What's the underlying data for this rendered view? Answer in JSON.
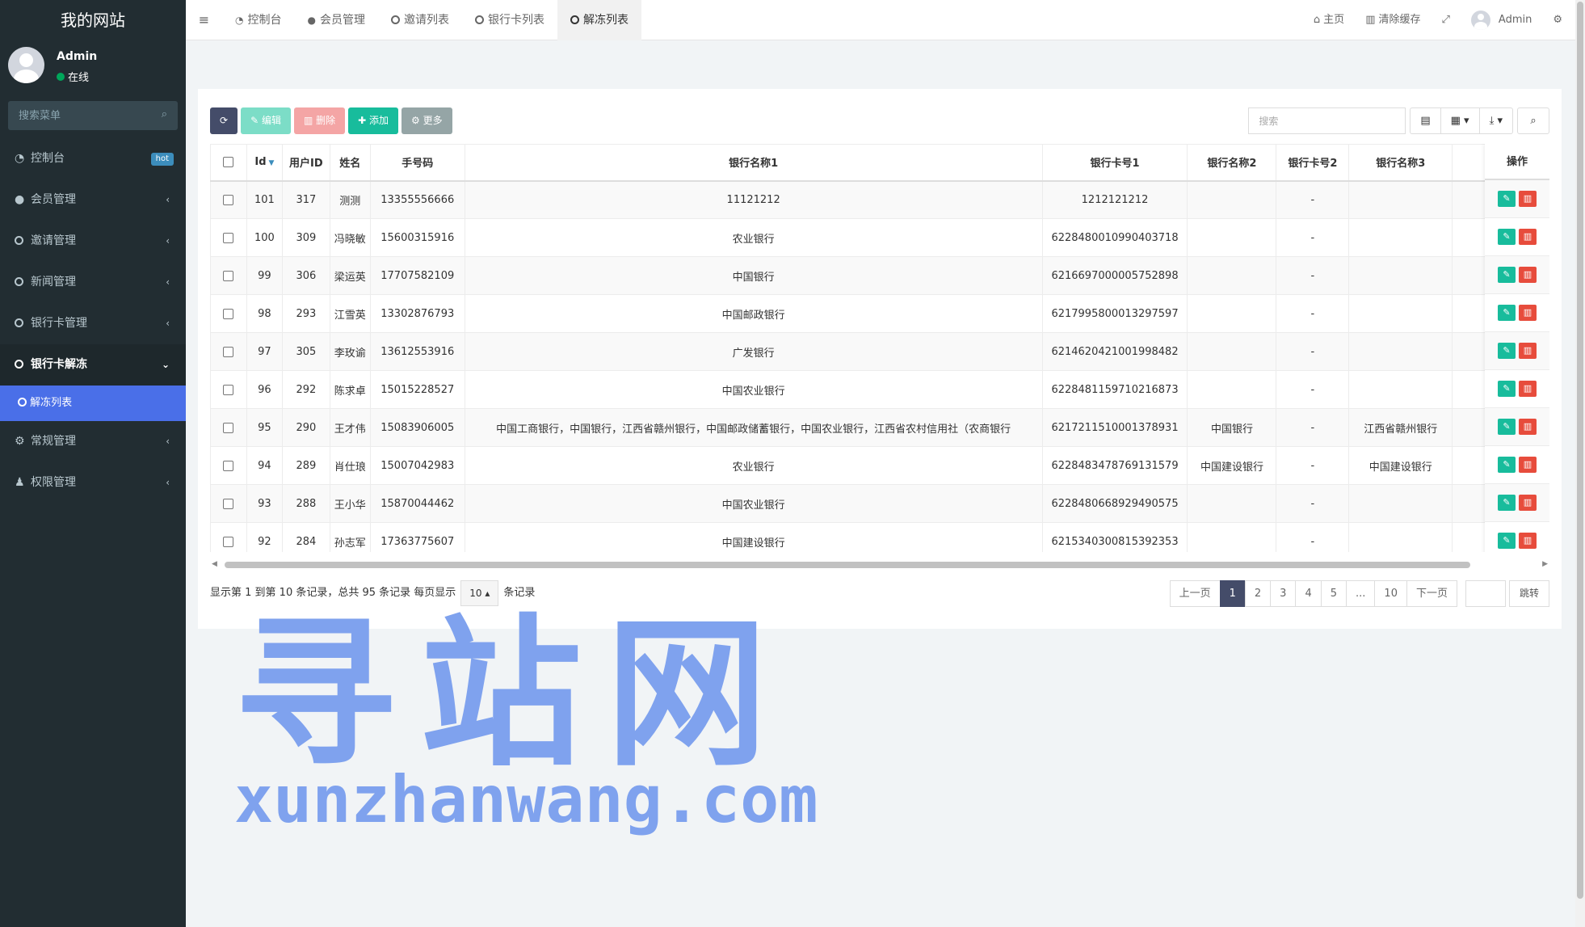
{
  "sidebar": {
    "logo": "我的网站",
    "user": {
      "name": "Admin",
      "status": "在线"
    },
    "search_placeholder": "搜索菜单",
    "items": [
      {
        "label": "控制台",
        "badge": "hot"
      },
      {
        "label": "会员管理"
      },
      {
        "label": "邀请管理"
      },
      {
        "label": "新闻管理"
      },
      {
        "label": "银行卡管理"
      },
      {
        "label": "银行卡解冻"
      },
      {
        "label": "解冻列表"
      },
      {
        "label": "常规管理"
      },
      {
        "label": "权限管理"
      }
    ]
  },
  "header": {
    "tabs": [
      "控制台",
      "会员管理",
      "邀请列表",
      "银行卡列表",
      "解冻列表"
    ],
    "home": "主页",
    "clear_cache": "清除缓存",
    "user": "Admin"
  },
  "toolbar": {
    "edit": "编辑",
    "delete": "删除",
    "add": "添加",
    "more": "更多",
    "search_placeholder": "搜索"
  },
  "table": {
    "columns": [
      "Id",
      "用户ID",
      "姓名",
      "手号码",
      "银行名称1",
      "银行卡号1",
      "银行名称2",
      "银行卡号2",
      "银行名称3"
    ],
    "op_header": "操作",
    "rows": [
      [
        "101",
        "317",
        "测测",
        "13355556666",
        "11121212",
        "1212121212",
        "",
        "-",
        ""
      ],
      [
        "100",
        "309",
        "冯晓敏",
        "15600315916",
        "农业银行",
        "6228480010990403718",
        "",
        "-",
        ""
      ],
      [
        "99",
        "306",
        "梁运英",
        "17707582109",
        "中国银行",
        "6216697000005752898",
        "",
        "-",
        ""
      ],
      [
        "98",
        "293",
        "江雪英",
        "13302876793",
        "中国邮政银行",
        "6217995800013297597",
        "",
        "-",
        ""
      ],
      [
        "97",
        "305",
        "李玫谕",
        "13612553916",
        "广发银行",
        "6214620421001998482",
        "",
        "-",
        ""
      ],
      [
        "96",
        "292",
        "陈求卓",
        "15015228527",
        "中国农业银行",
        "6228481159710216873",
        "",
        "-",
        ""
      ],
      [
        "95",
        "290",
        "王才伟",
        "15083906005",
        "中国工商银行，中国银行，江西省赣州银行，中国邮政储蓄银行，中国农业银行，江西省农村信用社（农商银行",
        "6217211510001378931",
        "中国银行",
        "-",
        "江西省赣州银行"
      ],
      [
        "94",
        "289",
        "肖仕琅",
        "15007042983",
        "农业银行",
        "6228483478769131579",
        "中国建设银行",
        "-",
        "中国建设银行"
      ],
      [
        "93",
        "288",
        "王小华",
        "15870044462",
        "中国农业银行",
        "6228480668929490575",
        "",
        "-",
        ""
      ],
      [
        "92",
        "284",
        "孙志军",
        "17363775607",
        "中国建设银行",
        "6215340300815392353",
        "",
        "-",
        ""
      ]
    ]
  },
  "footer": {
    "info_prefix": "显示第 1 到第 10 条记录，总共 95 条记录 每页显示",
    "page_size": "10",
    "info_suffix": "条记录",
    "pager": {
      "prev": "上一页",
      "pages": [
        "1",
        "2",
        "3",
        "4",
        "5",
        "...",
        "10"
      ],
      "next": "下一页",
      "go": "跳转"
    }
  },
  "watermark": {
    "cn": "寻站网",
    "en": "xunzhanwang.com"
  }
}
